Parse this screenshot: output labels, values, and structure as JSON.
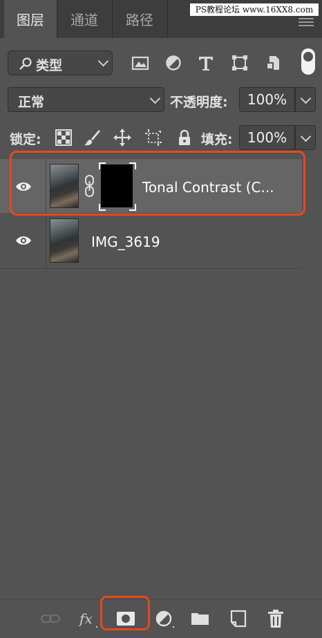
{
  "tabs": [
    {
      "label": "图层",
      "active": true
    },
    {
      "label": "通道",
      "active": false
    },
    {
      "label": "路径",
      "active": false
    }
  ],
  "watermark": "PS教程论坛 www.16XX8.com",
  "filter": {
    "kind_label": "类型",
    "icons": [
      "image-filter-icon",
      "adjustment-filter-icon",
      "type-filter-icon",
      "shape-filter-icon",
      "smart-object-filter-icon",
      "filter-toggle-icon"
    ]
  },
  "blend": {
    "mode": "正常",
    "opacity_label": "不透明度:",
    "opacity_value": "100%"
  },
  "lock": {
    "label": "锁定:",
    "fill_label": "填充:",
    "fill_value": "100%"
  },
  "layers": [
    {
      "name": "Tonal Contrast (C...",
      "selected": true,
      "has_mask": true,
      "visible": true
    },
    {
      "name": "IMG_3619",
      "selected": false,
      "has_mask": false,
      "visible": true
    }
  ],
  "colors": {
    "panel_bg": "#535353",
    "tab_bg": "#3d3d3d",
    "selected_row": "#656565",
    "highlight": "#e8481e"
  }
}
